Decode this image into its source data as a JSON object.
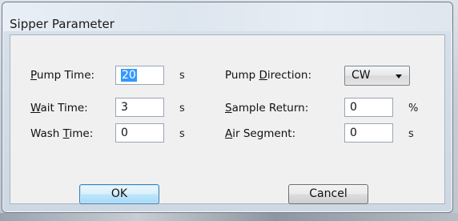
{
  "window": {
    "title": "Sipper Parameter"
  },
  "fields": {
    "pump_time": {
      "label_pre": "",
      "label_key": "P",
      "label_post": "ump Time:",
      "value": "20",
      "unit": "s"
    },
    "wait_time": {
      "label_pre": "",
      "label_key": "W",
      "label_post": "ait Time:",
      "value": "3",
      "unit": "s"
    },
    "wash_time": {
      "label_pre": "Wash ",
      "label_key": "T",
      "label_post": "ime:",
      "value": "0",
      "unit": "s"
    },
    "pump_direction": {
      "label_pre": "Pump ",
      "label_key": "D",
      "label_post": "irection:",
      "value": "CW"
    },
    "sample_return": {
      "label_pre": "",
      "label_key": "S",
      "label_post": "ample Return:",
      "value": "0",
      "unit": "%"
    },
    "air_segment": {
      "label_pre": "",
      "label_key": "A",
      "label_post": "ir Segment:",
      "value": "0",
      "unit": "s"
    }
  },
  "buttons": {
    "ok_label": "OK",
    "cancel_label": "Cancel"
  },
  "colors": {
    "selection": "#3399ff",
    "ok_border": "#3c7fb1"
  }
}
